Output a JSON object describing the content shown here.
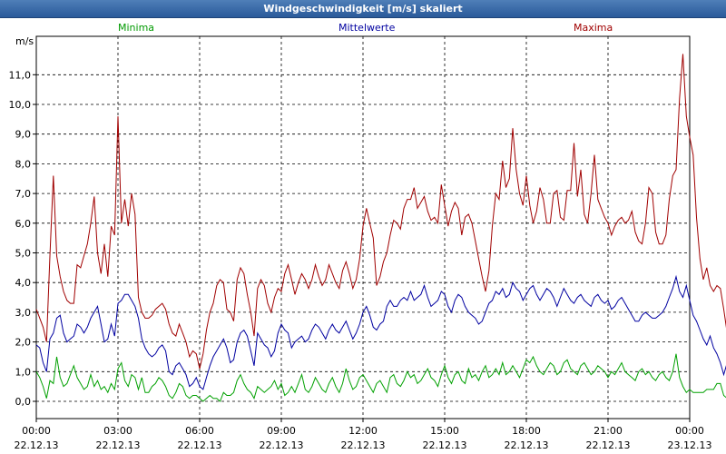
{
  "window": {
    "title": "Windgeschwindigkeit [m/s] skaliert"
  },
  "legend": {
    "minima": "Minima",
    "mean": "Mittelwerte",
    "maxima": "Maxima"
  },
  "colors": {
    "minima": "#00a000",
    "mean": "#0000a0",
    "maxima": "#a00000"
  },
  "chart_data": {
    "type": "line",
    "title": "Windgeschwindigkeit [m/s] skaliert",
    "ylabel": "m/s",
    "ylim": [
      -0.6,
      12.2
    ],
    "yticks": [
      "0,0",
      "1,0",
      "2,0",
      "3,0",
      "4,0",
      "5,0",
      "6,0",
      "7,0",
      "8,0",
      "9,0",
      "10,0",
      "11,0"
    ],
    "xlim": [
      0,
      24
    ],
    "xticks": [
      {
        "time": "00:00",
        "date": "22.12.13"
      },
      {
        "time": "03:00",
        "date": "22.12.13"
      },
      {
        "time": "06:00",
        "date": "22.12.13"
      },
      {
        "time": "09:00",
        "date": "22.12.13"
      },
      {
        "time": "12:00",
        "date": "22.12.13"
      },
      {
        "time": "15:00",
        "date": "22.12.13"
      },
      {
        "time": "18:00",
        "date": "22.12.13"
      },
      {
        "time": "21:00",
        "date": "22.12.13"
      },
      {
        "time": "00:00",
        "date": "23.12.13"
      }
    ],
    "grid": true,
    "x_step_hours": 0.125,
    "series": [
      {
        "name": "Maxima",
        "values": [
          3.1,
          2.8,
          2.5,
          2.0,
          4.9,
          7.6,
          4.9,
          4.2,
          3.7,
          3.4,
          3.3,
          3.3,
          4.6,
          4.5,
          4.9,
          5.3,
          6.0,
          6.9,
          5.0,
          4.3,
          5.3,
          4.2,
          5.9,
          5.6,
          9.6,
          6.0,
          6.8,
          5.9,
          7.0,
          6.3,
          3.5,
          3.0,
          2.8,
          2.8,
          2.9,
          3.1,
          3.2,
          3.3,
          3.1,
          2.6,
          2.3,
          2.2,
          2.6,
          2.3,
          2.0,
          1.5,
          1.7,
          1.6,
          1.1,
          1.6,
          2.4,
          3.0,
          3.3,
          3.9,
          4.1,
          4.0,
          3.1,
          3.0,
          2.7,
          4.1,
          4.5,
          4.3,
          3.6,
          3.0,
          2.2,
          3.8,
          4.1,
          3.9,
          3.3,
          3.0,
          3.5,
          3.8,
          3.7,
          4.3,
          4.6,
          4.1,
          3.6,
          4.0,
          4.3,
          4.1,
          3.8,
          4.1,
          4.6,
          4.2,
          3.9,
          4.1,
          4.6,
          4.3,
          4.0,
          3.8,
          4.4,
          4.7,
          4.3,
          3.8,
          4.1,
          4.8,
          5.9,
          6.5,
          6.0,
          5.5,
          3.9,
          4.2,
          4.7,
          5.0,
          5.6,
          6.1,
          6.0,
          5.8,
          6.5,
          6.8,
          6.8,
          7.2,
          6.5,
          6.7,
          6.9,
          6.4,
          6.1,
          6.2,
          6.0,
          7.3,
          6.6,
          5.9,
          6.4,
          6.7,
          6.5,
          5.6,
          6.2,
          6.3,
          6.0,
          5.4,
          4.8,
          4.2,
          3.7,
          4.4,
          5.9,
          7.0,
          6.8,
          8.1,
          7.2,
          7.5,
          9.2,
          7.8,
          7.0,
          6.6,
          7.6,
          6.6,
          6.0,
          6.4,
          7.2,
          6.8,
          6.0,
          6.0,
          7.0,
          7.1,
          6.2,
          6.1,
          7.1,
          7.1,
          8.7,
          6.9,
          7.8,
          6.3,
          6.0,
          7.0,
          8.3,
          6.8,
          6.5,
          6.2,
          6.0,
          5.6,
          5.9,
          6.1,
          6.2,
          6.0,
          6.1,
          6.4,
          5.7,
          5.4,
          5.3,
          6.0,
          7.2,
          7.0,
          5.7,
          5.3,
          5.3,
          5.6,
          6.8,
          7.6,
          7.8,
          10.2,
          11.7,
          9.6,
          8.9,
          8.3,
          6.2,
          4.8,
          4.1,
          4.5,
          3.9,
          3.7,
          3.9,
          3.8,
          3.1,
          2.3,
          3.5,
          2.8,
          2.4,
          3.7,
          4.5,
          4.0
        ]
      },
      {
        "name": "Mittelwerte",
        "values": [
          1.9,
          1.8,
          1.3,
          1.0,
          2.1,
          2.3,
          2.8,
          2.9,
          2.3,
          2.0,
          2.1,
          2.2,
          2.6,
          2.5,
          2.3,
          2.5,
          2.8,
          3.0,
          3.2,
          2.6,
          2.0,
          2.1,
          2.6,
          2.2,
          3.3,
          3.4,
          3.6,
          3.6,
          3.4,
          3.2,
          2.8,
          2.1,
          1.8,
          1.6,
          1.5,
          1.6,
          1.8,
          1.9,
          1.7,
          1.0,
          0.9,
          1.2,
          1.3,
          1.1,
          0.9,
          0.5,
          0.6,
          0.8,
          0.5,
          0.4,
          0.8,
          1.2,
          1.5,
          1.7,
          1.9,
          2.1,
          1.8,
          1.3,
          1.4,
          2.0,
          2.3,
          2.4,
          2.2,
          1.7,
          1.2,
          2.3,
          2.1,
          1.9,
          1.8,
          1.5,
          1.7,
          2.3,
          2.6,
          2.4,
          2.3,
          1.8,
          2.0,
          2.1,
          2.2,
          2.0,
          2.1,
          2.4,
          2.6,
          2.5,
          2.3,
          2.1,
          2.4,
          2.6,
          2.4,
          2.3,
          2.5,
          2.7,
          2.4,
          2.1,
          2.3,
          2.6,
          3.0,
          3.2,
          2.9,
          2.5,
          2.4,
          2.6,
          2.7,
          3.2,
          3.4,
          3.2,
          3.2,
          3.4,
          3.5,
          3.4,
          3.7,
          3.4,
          3.5,
          3.6,
          3.9,
          3.5,
          3.2,
          3.3,
          3.4,
          3.7,
          3.6,
          3.2,
          3.0,
          3.4,
          3.6,
          3.5,
          3.2,
          3.0,
          2.9,
          2.8,
          2.6,
          2.7,
          3.0,
          3.3,
          3.4,
          3.7,
          3.6,
          3.8,
          3.5,
          3.6,
          4.0,
          3.8,
          3.7,
          3.4,
          3.6,
          3.8,
          3.9,
          3.6,
          3.4,
          3.6,
          3.8,
          3.7,
          3.5,
          3.2,
          3.5,
          3.8,
          3.6,
          3.4,
          3.3,
          3.5,
          3.6,
          3.4,
          3.3,
          3.2,
          3.5,
          3.6,
          3.4,
          3.3,
          3.4,
          3.1,
          3.2,
          3.4,
          3.5,
          3.3,
          3.1,
          2.9,
          2.7,
          2.7,
          2.9,
          3.0,
          2.9,
          2.8,
          2.8,
          2.9,
          3.0,
          3.2,
          3.5,
          3.8,
          4.2,
          3.7,
          3.5,
          3.9,
          3.4,
          2.9,
          2.7,
          2.4,
          2.1,
          1.9,
          2.2,
          1.8,
          1.6,
          1.3,
          0.9,
          1.3,
          1.6,
          1.8,
          1.9,
          1.7
        ]
      },
      {
        "name": "Minima",
        "values": [
          1.0,
          0.8,
          0.5,
          0.1,
          0.7,
          0.6,
          1.5,
          0.8,
          0.5,
          0.6,
          0.9,
          1.2,
          0.8,
          0.6,
          0.4,
          0.5,
          0.9,
          0.5,
          0.7,
          0.4,
          0.5,
          0.3,
          0.6,
          0.4,
          1.1,
          1.3,
          0.7,
          0.5,
          0.9,
          0.8,
          0.4,
          0.8,
          0.3,
          0.3,
          0.5,
          0.6,
          0.8,
          0.7,
          0.5,
          0.2,
          0.1,
          0.3,
          0.6,
          0.5,
          0.2,
          0.1,
          0.2,
          0.2,
          0.1,
          0.0,
          0.1,
          0.2,
          0.1,
          0.1,
          0.0,
          0.3,
          0.2,
          0.2,
          0.3,
          0.7,
          0.9,
          0.6,
          0.4,
          0.3,
          0.1,
          0.5,
          0.4,
          0.3,
          0.4,
          0.5,
          0.7,
          0.4,
          0.6,
          0.2,
          0.3,
          0.5,
          0.3,
          0.6,
          0.9,
          0.4,
          0.3,
          0.5,
          0.8,
          0.6,
          0.4,
          0.3,
          0.6,
          0.8,
          0.5,
          0.3,
          0.6,
          1.1,
          0.7,
          0.4,
          0.5,
          0.8,
          0.9,
          0.7,
          0.5,
          0.3,
          0.6,
          0.7,
          0.5,
          0.3,
          0.8,
          0.9,
          0.6,
          0.5,
          0.7,
          1.0,
          0.8,
          0.9,
          0.6,
          0.7,
          0.9,
          1.1,
          0.8,
          0.7,
          0.5,
          0.9,
          1.2,
          0.8,
          0.6,
          0.9,
          1.0,
          0.7,
          0.6,
          1.1,
          0.8,
          0.9,
          0.7,
          1.0,
          1.2,
          0.8,
          0.9,
          1.1,
          0.9,
          1.3,
          0.9,
          1.0,
          1.2,
          1.0,
          0.8,
          1.1,
          1.4,
          1.3,
          1.5,
          1.2,
          1.0,
          0.9,
          1.1,
          1.3,
          1.2,
          0.9,
          1.0,
          1.3,
          1.4,
          1.1,
          1.0,
          0.9,
          1.2,
          1.3,
          1.1,
          0.9,
          1.0,
          1.2,
          1.1,
          1.0,
          0.8,
          1.0,
          0.9,
          1.1,
          1.3,
          1.0,
          0.9,
          0.8,
          0.7,
          1.0,
          1.1,
          0.9,
          1.0,
          0.8,
          0.7,
          0.9,
          1.0,
          0.8,
          0.7,
          1.0,
          1.6,
          0.8,
          0.5,
          0.3,
          0.4,
          0.3,
          0.3,
          0.3,
          0.3,
          0.4,
          0.4,
          0.4,
          0.6,
          0.6,
          0.2,
          0.1,
          0.4,
          0.1,
          0.6,
          0.3,
          0.6
        ]
      }
    ]
  }
}
